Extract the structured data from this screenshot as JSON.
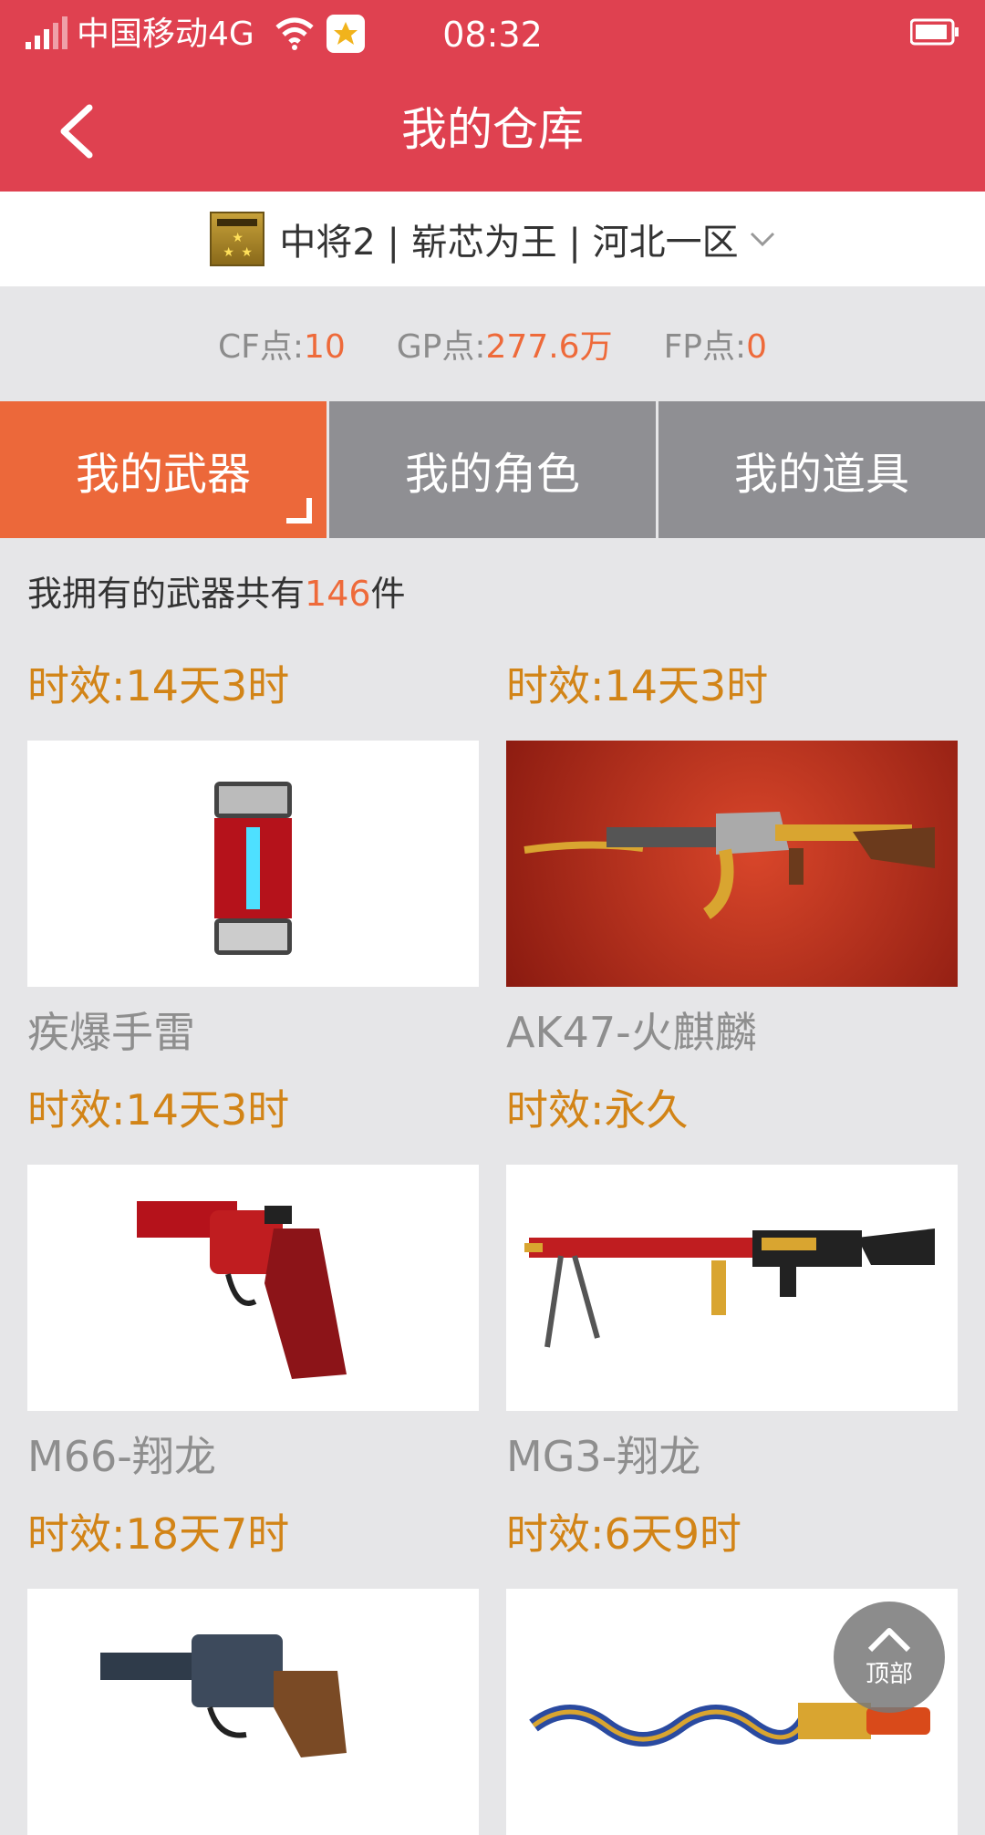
{
  "status_bar": {
    "carrier": "中国移动4G",
    "time": "08:32"
  },
  "nav": {
    "title": "我的仓库"
  },
  "account": {
    "info": "中将2 | 崭芯为王 | 河北一区"
  },
  "points": {
    "cf_label": "CF点:",
    "cf_value": "10",
    "gp_label": "GP点:",
    "gp_value": "277.6万",
    "fp_label": "FP点:",
    "fp_value": "0"
  },
  "tabs": [
    {
      "label": "我的武器",
      "active": true
    },
    {
      "label": "我的角色",
      "active": false
    },
    {
      "label": "我的道具",
      "active": false
    }
  ],
  "summary": {
    "prefix": "我拥有的武器共有",
    "count": "146",
    "suffix": "件"
  },
  "weapons": [
    {
      "duration": "时效:14天3时",
      "name": "疾爆手雷"
    },
    {
      "duration": "时效:14天3时",
      "name": "AK47-火麒麟"
    },
    {
      "duration": "时效:14天3时",
      "name": "M66-翔龙"
    },
    {
      "duration": "时效:永久",
      "name": "MG3-翔龙"
    },
    {
      "duration": "时效:18天7时",
      "name": ""
    },
    {
      "duration": "时效:6天9时",
      "name": ""
    }
  ],
  "back_to_top": {
    "label": "顶部"
  },
  "colors": {
    "header": "#df4150",
    "accent": "#ec683a",
    "duration": "#d28417",
    "tab_inactive": "#8f8f93"
  }
}
